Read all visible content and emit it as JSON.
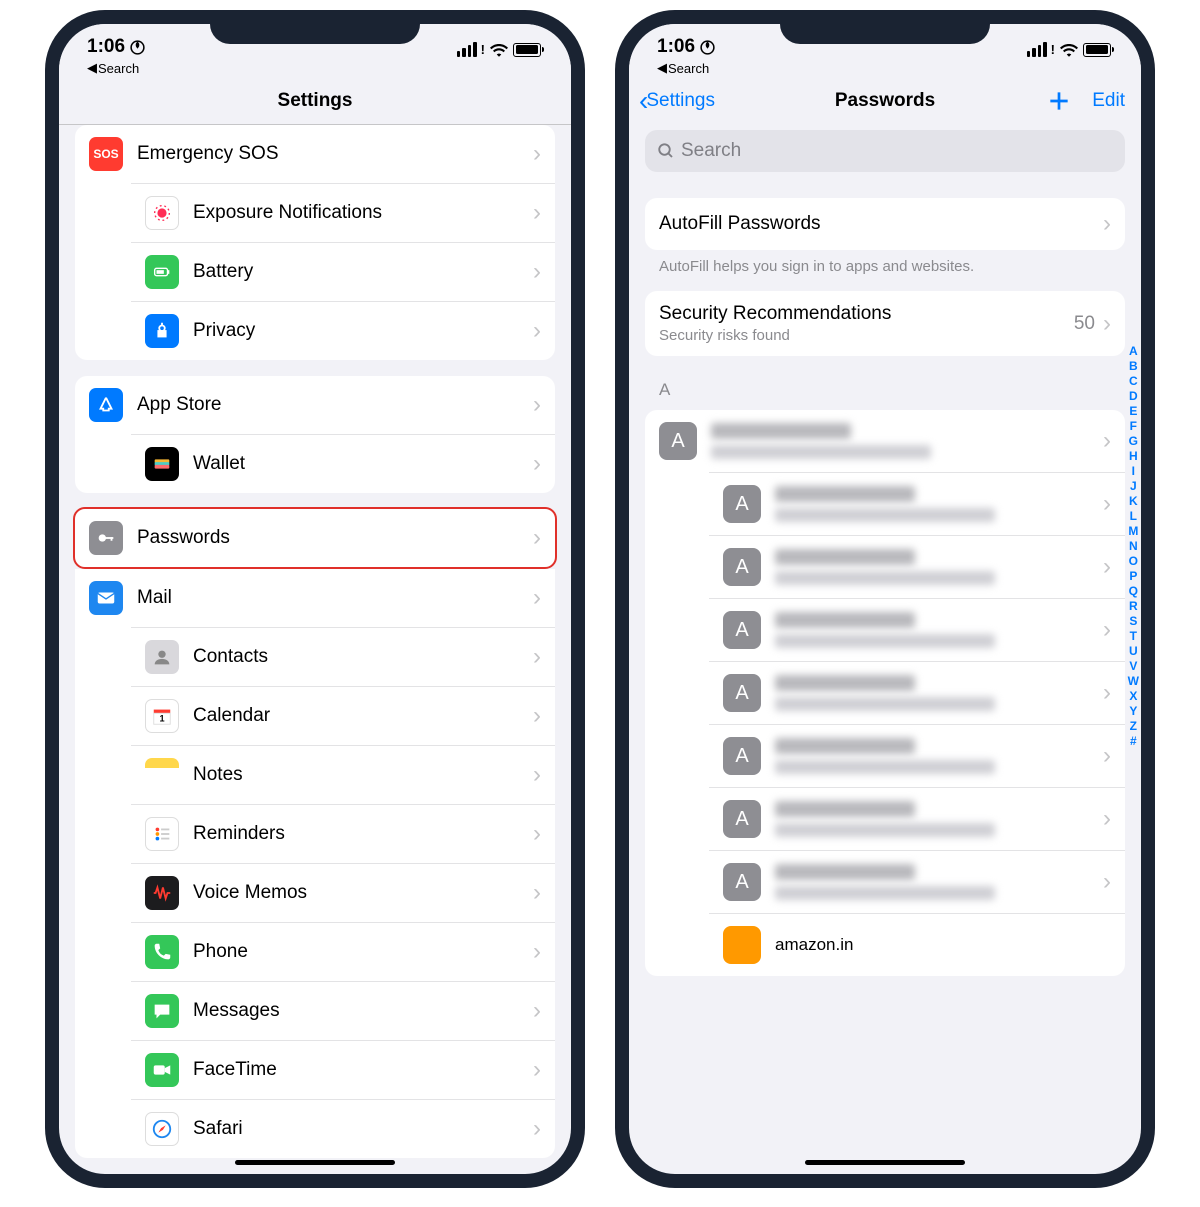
{
  "status": {
    "time": "1:06",
    "back_label": "Search"
  },
  "left": {
    "title": "Settings",
    "group1": [
      {
        "id": "sos",
        "label": "Emergency SOS",
        "bg": "bg-sos"
      },
      {
        "id": "exposure",
        "label": "Exposure Notifications",
        "bg": "bg-exp"
      },
      {
        "id": "battery",
        "label": "Battery",
        "bg": "bg-bat"
      },
      {
        "id": "privacy",
        "label": "Privacy",
        "bg": "bg-priv"
      }
    ],
    "group2": [
      {
        "id": "appstore",
        "label": "App Store",
        "bg": "bg-app"
      },
      {
        "id": "wallet",
        "label": "Wallet",
        "bg": "bg-wallet"
      }
    ],
    "group3": [
      {
        "id": "passwords",
        "label": "Passwords",
        "bg": "bg-pwd",
        "highlight": true
      },
      {
        "id": "mail",
        "label": "Mail",
        "bg": "bg-mail"
      },
      {
        "id": "contacts",
        "label": "Contacts",
        "bg": "bg-contacts"
      },
      {
        "id": "calendar",
        "label": "Calendar",
        "bg": "bg-cal"
      },
      {
        "id": "notes",
        "label": "Notes",
        "bg": "bg-notes"
      },
      {
        "id": "reminders",
        "label": "Reminders",
        "bg": "bg-rem"
      },
      {
        "id": "voicememos",
        "label": "Voice Memos",
        "bg": "bg-voice"
      },
      {
        "id": "phone",
        "label": "Phone",
        "bg": "bg-phone"
      },
      {
        "id": "messages",
        "label": "Messages",
        "bg": "bg-msg"
      },
      {
        "id": "facetime",
        "label": "FaceTime",
        "bg": "bg-ft"
      },
      {
        "id": "safari",
        "label": "Safari",
        "bg": "bg-safari"
      }
    ]
  },
  "right": {
    "back_label": "Settings",
    "title": "Passwords",
    "edit_label": "Edit",
    "search_placeholder": "Search",
    "autofill": {
      "label": "AutoFill Passwords",
      "hint": "AutoFill helps you sign in to apps and websites."
    },
    "security": {
      "label": "Security Recommendations",
      "sub": "Security risks found",
      "count": "50"
    },
    "section_letter": "A",
    "entries_count": 8,
    "last_visible": "amazon.in",
    "index": [
      "A",
      "B",
      "C",
      "D",
      "E",
      "F",
      "G",
      "H",
      "I",
      "J",
      "K",
      "L",
      "M",
      "N",
      "O",
      "P",
      "Q",
      "R",
      "S",
      "T",
      "U",
      "V",
      "W",
      "X",
      "Y",
      "Z",
      "#"
    ]
  }
}
